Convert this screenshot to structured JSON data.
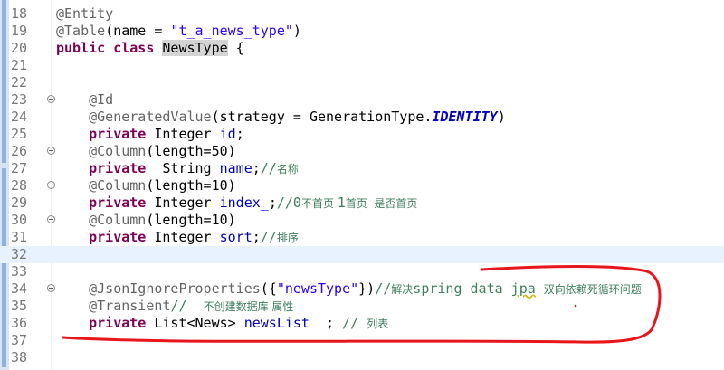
{
  "editor": {
    "lines": [
      {
        "num": "18",
        "tokens": [
          {
            "t": "@Entity",
            "c": "ann"
          }
        ]
      },
      {
        "num": "19",
        "tokens": [
          {
            "t": "@Table",
            "c": "ann"
          },
          {
            "t": "(name = "
          },
          {
            "t": "\"t_a_news_type\"",
            "c": "str"
          },
          {
            "t": ")"
          }
        ]
      },
      {
        "num": "20",
        "tokens": [
          {
            "t": "public",
            "c": "kw"
          },
          {
            "t": " "
          },
          {
            "t": "class",
            "c": "kw"
          },
          {
            "t": " "
          },
          {
            "t": "NewsType",
            "c": "sel"
          },
          {
            "t": " {"
          }
        ]
      },
      {
        "num": "21",
        "tokens": []
      },
      {
        "num": "22",
        "tokens": []
      },
      {
        "num": "23",
        "fold": true,
        "tokens": [
          {
            "t": "    "
          },
          {
            "t": "@Id",
            "c": "ann"
          }
        ]
      },
      {
        "num": "24",
        "tokens": [
          {
            "t": "    "
          },
          {
            "t": "@GeneratedValue",
            "c": "ann"
          },
          {
            "t": "(strategy = GenerationType."
          },
          {
            "t": "IDENTITY",
            "c": "con"
          },
          {
            "t": ")"
          }
        ]
      },
      {
        "num": "25",
        "tokens": [
          {
            "t": "    "
          },
          {
            "t": "private",
            "c": "kw"
          },
          {
            "t": " Integer "
          },
          {
            "t": "id",
            "c": "fld"
          },
          {
            "t": ";"
          }
        ]
      },
      {
        "num": "26",
        "fold": true,
        "tokens": [
          {
            "t": "    "
          },
          {
            "t": "@Column",
            "c": "ann"
          },
          {
            "t": "(length=50)"
          }
        ]
      },
      {
        "num": "27",
        "tokens": [
          {
            "t": "    "
          },
          {
            "t": "private",
            "c": "kw"
          },
          {
            "t": "  String "
          },
          {
            "t": "name",
            "c": "fld"
          },
          {
            "t": ";"
          },
          {
            "t": "//",
            "c": "cm"
          },
          {
            "t": "名称",
            "c": "cm cjk"
          }
        ]
      },
      {
        "num": "28",
        "fold": true,
        "tokens": [
          {
            "t": "    "
          },
          {
            "t": "@Column",
            "c": "ann"
          },
          {
            "t": "(length=10)"
          }
        ]
      },
      {
        "num": "29",
        "tokens": [
          {
            "t": "    "
          },
          {
            "t": "private",
            "c": "kw"
          },
          {
            "t": " Integer "
          },
          {
            "t": "index_",
            "c": "fld"
          },
          {
            "t": ";"
          },
          {
            "t": "//0",
            "c": "cm"
          },
          {
            "t": "不首页 ",
            "c": "cm cjk"
          },
          {
            "t": "1",
            "c": "cm"
          },
          {
            "t": "首页  是否首页",
            "c": "cm cjk"
          }
        ]
      },
      {
        "num": "30",
        "fold": true,
        "tokens": [
          {
            "t": "    "
          },
          {
            "t": "@Column",
            "c": "ann"
          },
          {
            "t": "(length=10)"
          }
        ]
      },
      {
        "num": "31",
        "tokens": [
          {
            "t": "    "
          },
          {
            "t": "private",
            "c": "kw"
          },
          {
            "t": " Integer "
          },
          {
            "t": "sort",
            "c": "fld"
          },
          {
            "t": ";"
          },
          {
            "t": "//",
            "c": "cm"
          },
          {
            "t": "排序",
            "c": "cm cjk"
          }
        ]
      },
      {
        "num": "32",
        "hl": true,
        "tokens": []
      },
      {
        "num": "33",
        "tokens": []
      },
      {
        "num": "34",
        "fold": true,
        "tokens": [
          {
            "t": "    "
          },
          {
            "t": "@JsonIgnoreProperties",
            "c": "ann"
          },
          {
            "t": "({"
          },
          {
            "t": "\"newsType\"",
            "c": "str"
          },
          {
            "t": "})"
          },
          {
            "t": "//",
            "c": "cm"
          },
          {
            "t": "解决",
            "c": "cm cjk"
          },
          {
            "t": "spring data ",
            "c": "cm"
          },
          {
            "t": "jpa",
            "c": "cm squig"
          },
          {
            "t": " ",
            "c": "cm"
          },
          {
            "t": "双向依赖死循环问题",
            "c": "cm cjk"
          }
        ]
      },
      {
        "num": "35",
        "tokens": [
          {
            "t": "    "
          },
          {
            "t": "@Transient",
            "c": "ann"
          },
          {
            "t": "//  ",
            "c": "cm"
          },
          {
            "t": "不创建数据库 属性",
            "c": "cm cjk"
          }
        ]
      },
      {
        "num": "36",
        "tokens": [
          {
            "t": "    "
          },
          {
            "t": "private",
            "c": "kw"
          },
          {
            "t": " List<News> "
          },
          {
            "t": "newsList",
            "c": "fld"
          },
          {
            "t": "  ; "
          },
          {
            "t": "// ",
            "c": "cm"
          },
          {
            "t": "列表",
            "c": "cm cjk"
          }
        ]
      },
      {
        "num": "37",
        "tokens": []
      },
      {
        "num": "38",
        "tokens": []
      }
    ],
    "colors": {
      "annotation_pen": "#e8161b",
      "keyword": "#7f0055",
      "string": "#2a00ff",
      "comment": "#3f7f5f",
      "field": "#0000c0"
    }
  }
}
